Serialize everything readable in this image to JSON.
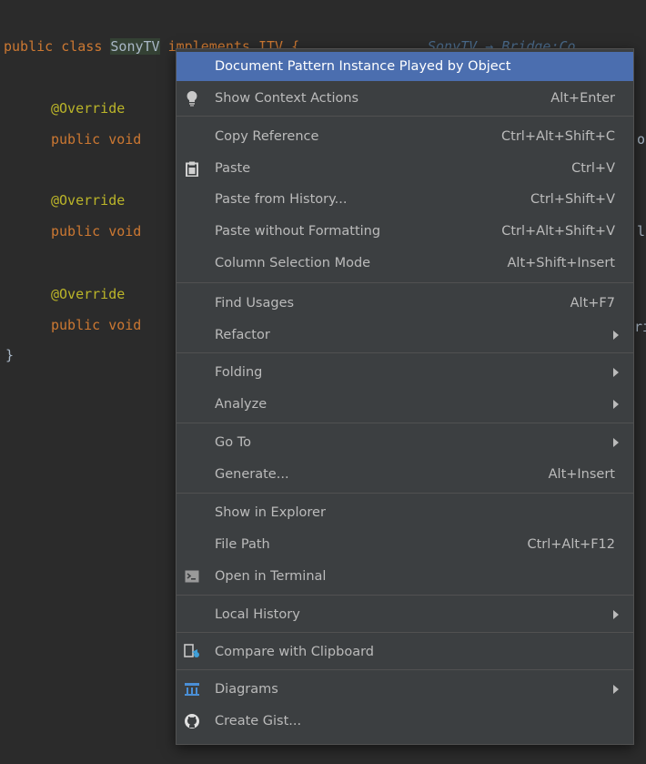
{
  "editor": {
    "line1_kw1": "public class ",
    "line1_class": "SonyTV",
    "line1_impl": " implements ITV {",
    "line1_ghost": "SonyTV → Bridge:Co",
    "override1": "@Override",
    "method1": "public void",
    "method1_tail": "o",
    "override2": "@Override",
    "method2": "public void",
    "method2_tail": "l",
    "override3": "@Override",
    "method3": "public void",
    "method3_tail": "ri",
    "close_brace": "}"
  },
  "menu": {
    "items": [
      {
        "label": "Document Pattern Instance Played by Object",
        "shortcut": "",
        "icon": "",
        "submenu": false,
        "selected": true
      },
      {
        "label": "Show Context Actions",
        "shortcut": "Alt+Enter",
        "icon": "lightbulb-icon",
        "submenu": false
      },
      {
        "label": "Copy Reference",
        "shortcut": "Ctrl+Alt+Shift+C",
        "icon": "",
        "submenu": false
      },
      {
        "label": "Paste",
        "shortcut": "Ctrl+V",
        "icon": "clipboard-icon",
        "submenu": false
      },
      {
        "label": "Paste from History...",
        "shortcut": "Ctrl+Shift+V",
        "icon": "",
        "submenu": false
      },
      {
        "label": "Paste without Formatting",
        "shortcut": "Ctrl+Alt+Shift+V",
        "icon": "",
        "submenu": false
      },
      {
        "label": "Column Selection Mode",
        "shortcut": "Alt+Shift+Insert",
        "icon": "",
        "submenu": false
      },
      {
        "label": "Find Usages",
        "shortcut": "Alt+F7",
        "icon": "",
        "submenu": false
      },
      {
        "label": "Refactor",
        "shortcut": "",
        "icon": "",
        "submenu": true
      },
      {
        "label": "Folding",
        "shortcut": "",
        "icon": "",
        "submenu": true
      },
      {
        "label": "Analyze",
        "shortcut": "",
        "icon": "",
        "submenu": true
      },
      {
        "label": "Go To",
        "shortcut": "",
        "icon": "",
        "submenu": true
      },
      {
        "label": "Generate...",
        "shortcut": "Alt+Insert",
        "icon": "",
        "submenu": false
      },
      {
        "label": "Show in Explorer",
        "shortcut": "",
        "icon": "",
        "submenu": false
      },
      {
        "label": "File Path",
        "shortcut": "Ctrl+Alt+F12",
        "icon": "",
        "submenu": false
      },
      {
        "label": "Open in Terminal",
        "shortcut": "",
        "icon": "terminal-icon",
        "submenu": false
      },
      {
        "label": "Local History",
        "shortcut": "",
        "icon": "",
        "submenu": true
      },
      {
        "label": "Compare with Clipboard",
        "shortcut": "",
        "icon": "compare-icon",
        "submenu": false
      },
      {
        "label": "Diagrams",
        "shortcut": "",
        "icon": "diagram-icon",
        "submenu": true
      },
      {
        "label": "Create Gist...",
        "shortcut": "",
        "icon": "github-icon",
        "submenu": false
      }
    ]
  },
  "colors": {
    "background": "#2b2b2b",
    "menu_bg": "#3c3f41",
    "selection": "#4b6eaf",
    "keyword": "#cc7832",
    "annotation": "#bbb529"
  }
}
